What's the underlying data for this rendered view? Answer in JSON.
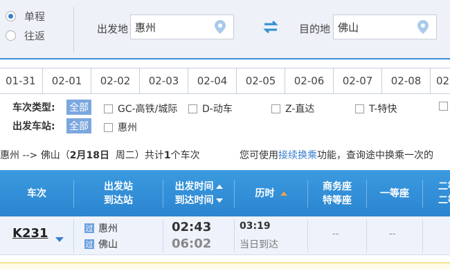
{
  "trip_type": {
    "options": [
      {
        "label": "单程",
        "checked": true
      },
      {
        "label": "往返",
        "checked": false
      }
    ]
  },
  "search": {
    "from_label": "出发地",
    "from_value": "惠州",
    "to_label": "目的地",
    "to_value": "佛山"
  },
  "date_tabs": [
    "01-31",
    "02-01",
    "02-02",
    "02-03",
    "02-04",
    "02-05",
    "02-06",
    "02-07",
    "02-08",
    "02"
  ],
  "filters": {
    "train_type_title": "车次类型:",
    "all_label": "全部",
    "train_types": [
      "GC-高铁/城际",
      "D-动车",
      "Z-直达",
      "T-特快"
    ],
    "station_title": "出发车站:",
    "stations": [
      "惠州"
    ]
  },
  "summary": {
    "route": "惠州 --> 佛山（",
    "date": "2月18日",
    "weekday": "周二",
    "close": "）",
    "total_prefix": "共计",
    "count": "1",
    "total_suffix": "个车次",
    "hint_prefix": "您可使用",
    "hint_link": "接续换乘",
    "hint_suffix": "功能，查询途中换乘一次的"
  },
  "table_header": {
    "train": "车次",
    "dep_station": "出发站",
    "arr_station": "到达站",
    "dep_time": "出发时间",
    "arr_time": "到达时间",
    "duration": "历时",
    "business": "商务座",
    "premium": "特等座",
    "first": "一等座",
    "second_a": "二等",
    "second_b": "二等"
  },
  "rows": [
    {
      "train_no": "K231",
      "badge_from": "过",
      "from": "惠州",
      "badge_to": "过",
      "to": "佛山",
      "dep": "02:43",
      "arr": "06:02",
      "duration": "03:19",
      "arrive_note": "当日到达",
      "business": "--",
      "first": "--"
    }
  ],
  "colors": {
    "accent": "#3a8fd6",
    "header_blue": "#2b85cf",
    "link_blue": "#3a7fd0",
    "tag_blue": "#7ba7de",
    "sort_orange": "#f0a14a"
  }
}
